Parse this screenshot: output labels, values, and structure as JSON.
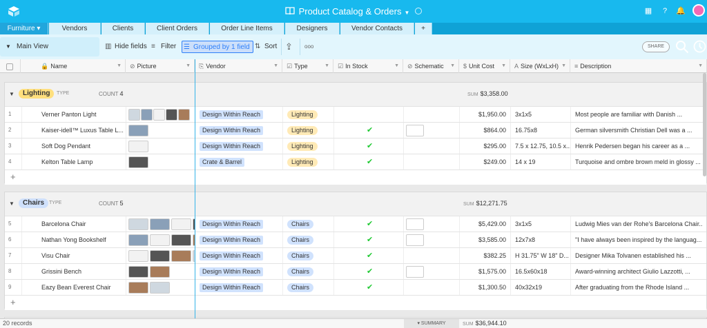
{
  "app": {
    "title": "Product Catalog & Orders",
    "avatar_initial": ""
  },
  "tabs": [
    {
      "label": "Furniture ▾",
      "active": true
    },
    {
      "label": "Vendors"
    },
    {
      "label": "Clients"
    },
    {
      "label": "Client Orders"
    },
    {
      "label": "Order Line Items"
    },
    {
      "label": "Designers"
    },
    {
      "label": "Vendor Contacts"
    },
    {
      "label": "+"
    }
  ],
  "toolbar": {
    "view": "Main View",
    "hide_fields": "Hide fields",
    "filter": "Filter",
    "grouped": "Grouped by 1 field",
    "sort": "Sort",
    "share": "SHARE",
    "more": "ooo"
  },
  "columns": [
    "Name",
    "Picture",
    "Vendor",
    "Type",
    "In Stock",
    "Schematic",
    "Unit Cost",
    "Size (WxLxH)",
    "Description"
  ],
  "groups": [
    {
      "label": "Lighting",
      "type_label": "TYPE",
      "count_label": "COUNT",
      "count": "4",
      "sum_label": "SUM",
      "sum": "$3,358.00",
      "color": "#ffdf7e",
      "rows": [
        {
          "n": "1",
          "name": "Verner Panton Light",
          "vendor": "Design Within Reach",
          "type": "Lighting",
          "instock": false,
          "cost": "$1,950.00",
          "size": "3x1x5",
          "desc": "Most people are familiar with Danish ..."
        },
        {
          "n": "2",
          "name": "Kaiser-idell™ Luxus Table L...",
          "vendor": "Design Within Reach",
          "type": "Lighting",
          "instock": true,
          "cost": "$864.00",
          "size": "16.75x8",
          "desc": "German silversmith Christian Dell was a ..."
        },
        {
          "n": "3",
          "name": "Soft Dog Pendant",
          "vendor": "Design Within Reach",
          "type": "Lighting",
          "instock": true,
          "cost": "$295.00",
          "size": "7.5 x 12.75, 10.5 x...",
          "desc": "Henrik Pedersen began his career as a ..."
        },
        {
          "n": "4",
          "name": "Kelton Table Lamp",
          "vendor": "Crate & Barrel",
          "type": "Lighting",
          "instock": true,
          "cost": "$249.00",
          "size": "14 x 19",
          "desc": "Turquoise and ombre brown meld in glossy ..."
        }
      ]
    },
    {
      "label": "Chairs",
      "type_label": "TYPE",
      "count_label": "COUNT",
      "count": "5",
      "sum_label": "SUM",
      "sum": "$12,271.75",
      "color": "#cfe0fb",
      "rows": [
        {
          "n": "5",
          "name": "Barcelona Chair",
          "vendor": "Design Within Reach",
          "type": "Chairs",
          "instock": true,
          "cost": "$5,429.00",
          "size": "3x1x5",
          "desc": "Ludwig Mies van der Rohe's Barcelona Chair..."
        },
        {
          "n": "6",
          "name": "Nathan Yong Bookshelf",
          "vendor": "Design Within Reach",
          "type": "Chairs",
          "instock": true,
          "cost": "$3,585.00",
          "size": "12x7x8",
          "desc": "\"I have always been inspired by the languag..."
        },
        {
          "n": "7",
          "name": "Visu Chair",
          "vendor": "Design Within Reach",
          "type": "Chairs",
          "instock": true,
          "cost": "$382.25",
          "size": "H 31.75\" W 18\" D...",
          "desc": "Designer Mika Tolvanen established his ..."
        },
        {
          "n": "8",
          "name": "Grissini Bench",
          "vendor": "Design Within Reach",
          "type": "Chairs",
          "instock": true,
          "cost": "$1,575.00",
          "size": "16.5x60x18",
          "desc": "Award-winning architect Giulio Lazzotti, ..."
        },
        {
          "n": "9",
          "name": "Eazy Bean Everest Chair",
          "vendor": "Design Within Reach",
          "type": "Chairs",
          "instock": true,
          "cost": "$1,300.50",
          "size": "40x32x19",
          "desc": "After graduating from the Rhode Island ..."
        }
      ]
    }
  ],
  "footer": {
    "records": "20 records",
    "summary": "▾ SUMMARY",
    "sum_label": "SUM",
    "sum": "$36,944.10"
  },
  "colors": {
    "header": "#18b9ee",
    "tabbar": "#0fa2d6",
    "accent": "#2d7ff9",
    "check": "#20c933"
  }
}
